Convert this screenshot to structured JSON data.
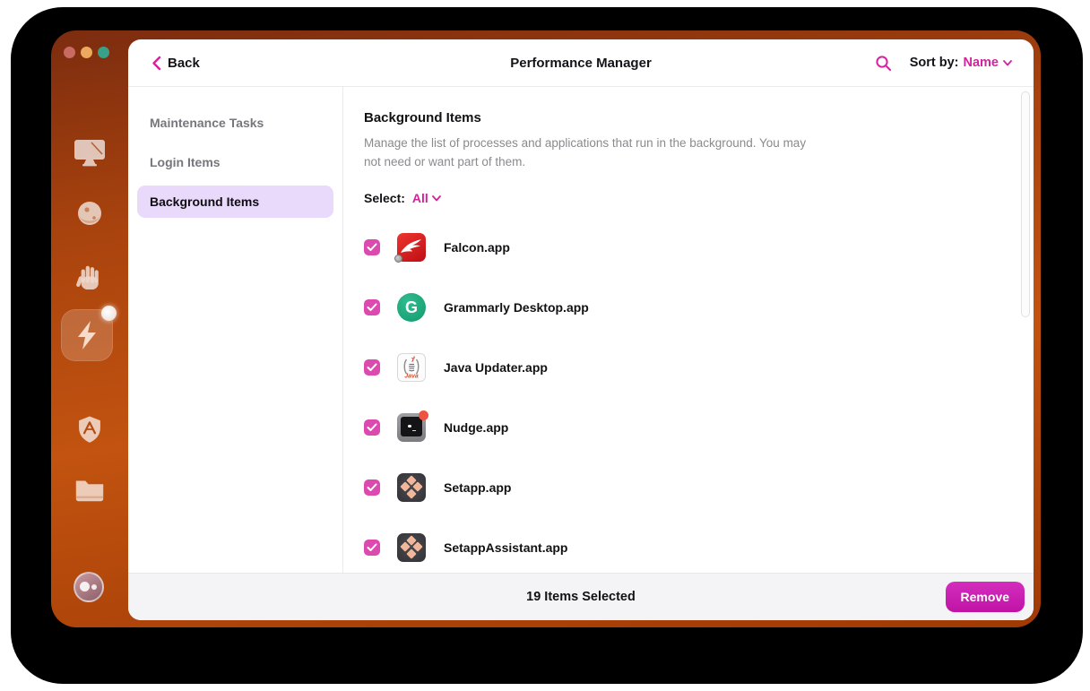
{
  "window": {
    "traffic_lights": [
      {
        "name": "close-button",
        "color": "#c96b62"
      },
      {
        "name": "minimize-button",
        "color": "#eca95e"
      },
      {
        "name": "zoom-button",
        "color": "#37a189"
      }
    ]
  },
  "header": {
    "back_label": "Back",
    "title": "Performance Manager",
    "sort_label": "Sort by:",
    "sort_value": "Name"
  },
  "sidebar": {
    "icons": [
      "monitor-icon",
      "sphere-icon",
      "hand-icon",
      "lightning-bolt-icon",
      "shield-icon",
      "folder-icon"
    ],
    "active_icon": "lightning-bolt-icon",
    "active_badge": "notification-dot",
    "avatar": "user-avatar"
  },
  "nav": {
    "items": [
      {
        "label": "Maintenance Tasks",
        "active": false
      },
      {
        "label": "Login Items",
        "active": false
      },
      {
        "label": "Background Items",
        "active": true
      }
    ]
  },
  "content": {
    "title": "Background Items",
    "description": "Manage the list of processes and applications that run in the background. You may not need or want part of them.",
    "select_label": "Select:",
    "select_value": "All",
    "items": [
      {
        "name": "Falcon.app",
        "icon": "falcon-app-icon",
        "checked": true
      },
      {
        "name": "Grammarly Desktop.app",
        "icon": "grammarly-app-icon",
        "checked": true
      },
      {
        "name": "Java Updater.app",
        "icon": "java-app-icon",
        "checked": true
      },
      {
        "name": "Nudge.app",
        "icon": "nudge-app-icon",
        "checked": true
      },
      {
        "name": "Setapp.app",
        "icon": "setapp-app-icon",
        "checked": true
      },
      {
        "name": "SetappAssistant.app",
        "icon": "setapp-app-icon",
        "checked": true
      }
    ],
    "grammarly_glyph": "G",
    "java_glyph": "Java"
  },
  "footer": {
    "status": "19 Items Selected",
    "remove_label": "Remove"
  },
  "colors": {
    "accent_pink": "#d6219c",
    "checkbox_pink": "#dc4ab0",
    "remove_button": "#c81cae",
    "active_nav_bg": "#e9d9fb",
    "window_orange": "#bb4e10",
    "footer_bg": "#f4f3f5"
  }
}
